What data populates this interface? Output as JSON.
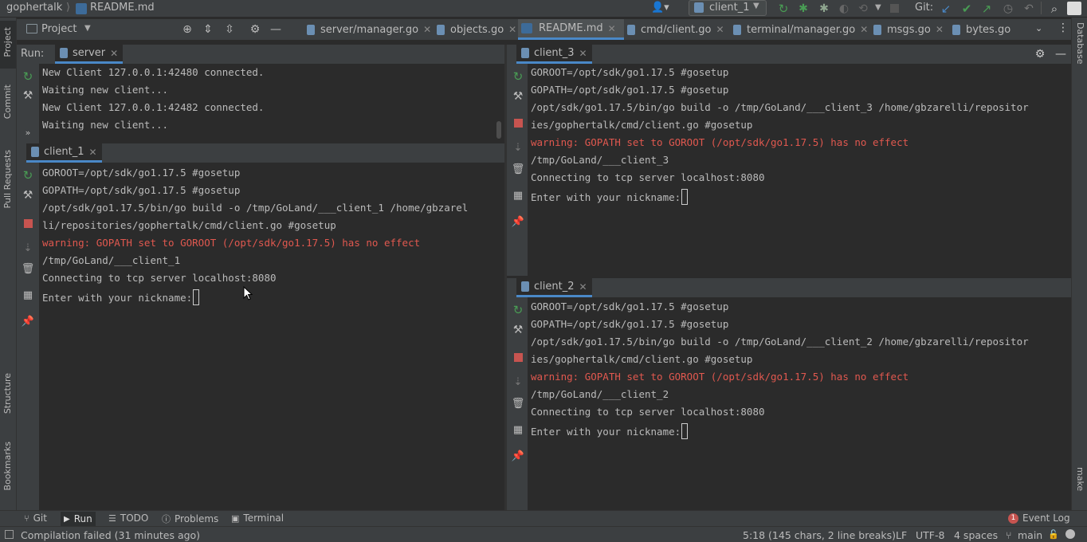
{
  "nav": {
    "project": "gophertalk",
    "file": "README.md",
    "run_config": "client_1",
    "git_label": "Git:"
  },
  "project_panel": {
    "label": "Project"
  },
  "editor_tabs": [
    {
      "label": "server/manager.go"
    },
    {
      "label": "objects.go"
    },
    {
      "label": "README.md"
    },
    {
      "label": "cmd/client.go"
    },
    {
      "label": "terminal/manager.go"
    },
    {
      "label": "msgs.go"
    },
    {
      "label": "bytes.go"
    }
  ],
  "left_stripe": {
    "project": "Project",
    "commit": "Commit",
    "pull_requests": "Pull Requests",
    "structure": "Structure",
    "bookmarks": "Bookmarks"
  },
  "right_stripe": {
    "database": "Database",
    "make": "make"
  },
  "run_panel": {
    "label": "Run:",
    "server_tab": "server",
    "server_lines": [
      "New Client 127.0.0.1:42480 connected.",
      "Waiting new client...",
      "New Client 127.0.0.1:42482 connected.",
      "Waiting new client..."
    ],
    "client1_tab": "client_1",
    "client1_lines": [
      {
        "text": "GOROOT=/opt/sdk/go1.17.5 #gosetup",
        "warn": false
      },
      {
        "text": "GOPATH=/opt/sdk/go1.17.5 #gosetup",
        "warn": false
      },
      {
        "text": "/opt/sdk/go1.17.5/bin/go build -o /tmp/GoLand/___client_1 /home/gbzarel",
        "warn": false
      },
      {
        "text": "li/repositories/gophertalk/cmd/client.go #gosetup",
        "warn": false
      },
      {
        "text": "warning: GOPATH set to GOROOT (/opt/sdk/go1.17.5) has no effect",
        "warn": true
      },
      {
        "text": "/tmp/GoLand/___client_1",
        "warn": false
      },
      {
        "text": "Connecting to tcp server localhost:8080",
        "warn": false
      },
      {
        "text": "Enter with your nickname:",
        "warn": false
      }
    ],
    "client3_tab": "client_3",
    "client3_lines": [
      {
        "text": "GOROOT=/opt/sdk/go1.17.5 #gosetup",
        "warn": false
      },
      {
        "text": "GOPATH=/opt/sdk/go1.17.5 #gosetup",
        "warn": false
      },
      {
        "text": "/opt/sdk/go1.17.5/bin/go build -o /tmp/GoLand/___client_3 /home/gbzarelli/repositor",
        "warn": false
      },
      {
        "text": "ies/gophertalk/cmd/client.go #gosetup",
        "warn": false
      },
      {
        "text": "warning: GOPATH set to GOROOT (/opt/sdk/go1.17.5) has no effect",
        "warn": true
      },
      {
        "text": "/tmp/GoLand/___client_3",
        "warn": false
      },
      {
        "text": "Connecting to tcp server localhost:8080",
        "warn": false
      },
      {
        "text": "Enter with your nickname:",
        "warn": false
      }
    ],
    "client2_tab": "client_2",
    "client2_lines": [
      {
        "text": "GOROOT=/opt/sdk/go1.17.5 #gosetup",
        "warn": false
      },
      {
        "text": "GOPATH=/opt/sdk/go1.17.5 #gosetup",
        "warn": false
      },
      {
        "text": "/opt/sdk/go1.17.5/bin/go build -o /tmp/GoLand/___client_2 /home/gbzarelli/repositor",
        "warn": false
      },
      {
        "text": "ies/gophertalk/cmd/client.go #gosetup",
        "warn": false
      },
      {
        "text": "warning: GOPATH set to GOROOT (/opt/sdk/go1.17.5) has no effect",
        "warn": true
      },
      {
        "text": "/tmp/GoLand/___client_2",
        "warn": false
      },
      {
        "text": "Connecting to tcp server localhost:8080",
        "warn": false
      },
      {
        "text": "Enter with your nickname:",
        "warn": false
      }
    ]
  },
  "bottom_tabs": [
    {
      "label": "Git",
      "icon": "git-branch-icon"
    },
    {
      "label": "Run",
      "icon": "run-icon"
    },
    {
      "label": "TODO",
      "icon": "list-icon"
    },
    {
      "label": "Problems",
      "icon": "info-icon"
    },
    {
      "label": "Terminal",
      "icon": "terminal-icon"
    }
  ],
  "event_log": {
    "label": "Event Log",
    "count": "1"
  },
  "status": {
    "message": "Compilation failed (31 minutes ago)",
    "position": "5:18 (145 chars, 2 line breaks)",
    "line_sep": "LF",
    "encoding": "UTF-8",
    "indent": "4 spaces",
    "branch": "main"
  },
  "colors": {
    "accent": "#4a88c7",
    "warning": "#e0584f",
    "run_green": "#499c54",
    "stop_red": "#c75450"
  }
}
